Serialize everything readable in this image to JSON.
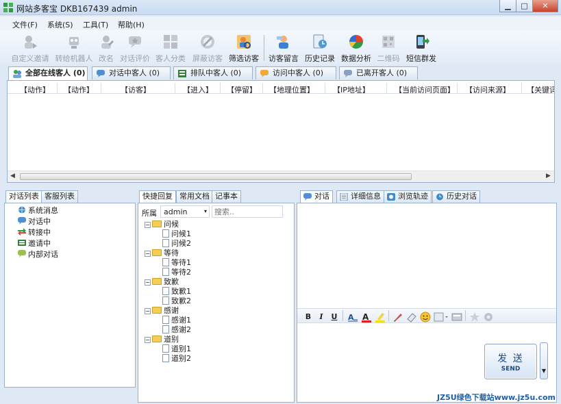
{
  "window": {
    "title": "网站多客宝  DKB167439  admin",
    "min": "▁",
    "max": "□",
    "close": "✕"
  },
  "menu": [
    "文件(F)",
    "系统(S)",
    "工具(T)",
    "帮助(H)"
  ],
  "toolbar": [
    {
      "label": "自定义邀请",
      "icon": "custom-invite-icon",
      "enabled": false
    },
    {
      "label": "转给机器人",
      "icon": "robot-transfer-icon",
      "enabled": false
    },
    {
      "label": "改名",
      "icon": "rename-icon",
      "enabled": false
    },
    {
      "label": "对话评价",
      "icon": "rating-icon",
      "enabled": false
    },
    {
      "label": "客人分类",
      "icon": "classify-icon",
      "enabled": false
    },
    {
      "label": "屏蔽访客",
      "icon": "block-icon",
      "enabled": false
    },
    {
      "label": "筛选访客",
      "icon": "filter-visitor-icon",
      "enabled": true
    },
    {
      "label": "访客留言",
      "icon": "guest-message-icon",
      "enabled": true
    },
    {
      "label": "历史记录",
      "icon": "history-icon",
      "enabled": true
    },
    {
      "label": "数据分析",
      "icon": "analytics-icon",
      "enabled": true
    },
    {
      "label": "二维码",
      "icon": "qrcode-icon",
      "enabled": false
    },
    {
      "label": "短信群发",
      "icon": "sms-icon",
      "enabled": true
    }
  ],
  "visitor_tabs": [
    "全部在线客人 (0)",
    "对话中客人 (0)",
    "排队中客人 (0)",
    "访问中客人 (0)",
    "已离开客人 (0)"
  ],
  "columns": [
    "【动作】",
    "【动作】",
    "【访客】",
    "【进入】",
    "【停留】",
    "【地理位置】",
    "【IP地址】",
    "【当前访问页面】",
    "【访问来源】",
    "【关键词"
  ],
  "left_tabs": [
    "对话列表",
    "客服列表"
  ],
  "conv_tree": [
    "系统消息",
    "对话中",
    "转接中",
    "邀请中",
    "内部对话"
  ],
  "mid_tabs": [
    "快捷回复",
    "常用文档",
    "记事本"
  ],
  "owner_label": "所属",
  "owner_value": "admin",
  "search_placeholder": "搜索..",
  "reply_tree": [
    {
      "group": "问候",
      "items": [
        "问候1",
        "问候2"
      ]
    },
    {
      "group": "等待",
      "items": [
        "等待1",
        "等待2"
      ]
    },
    {
      "group": "致歉",
      "items": [
        "致歉1",
        "致歉2"
      ]
    },
    {
      "group": "感谢",
      "items": [
        "感谢1",
        "感谢2"
      ]
    },
    {
      "group": "道别",
      "items": [
        "道别1",
        "道别2"
      ]
    }
  ],
  "right_tabs": [
    "对话",
    "详细信息",
    "浏览轨迹",
    "历史对话"
  ],
  "format_tools": [
    "B",
    "I",
    "U"
  ],
  "send": {
    "cn": "发 送",
    "en": "SEND"
  },
  "watermark": "JZ5U绿色下载站www.jz5u.com"
}
